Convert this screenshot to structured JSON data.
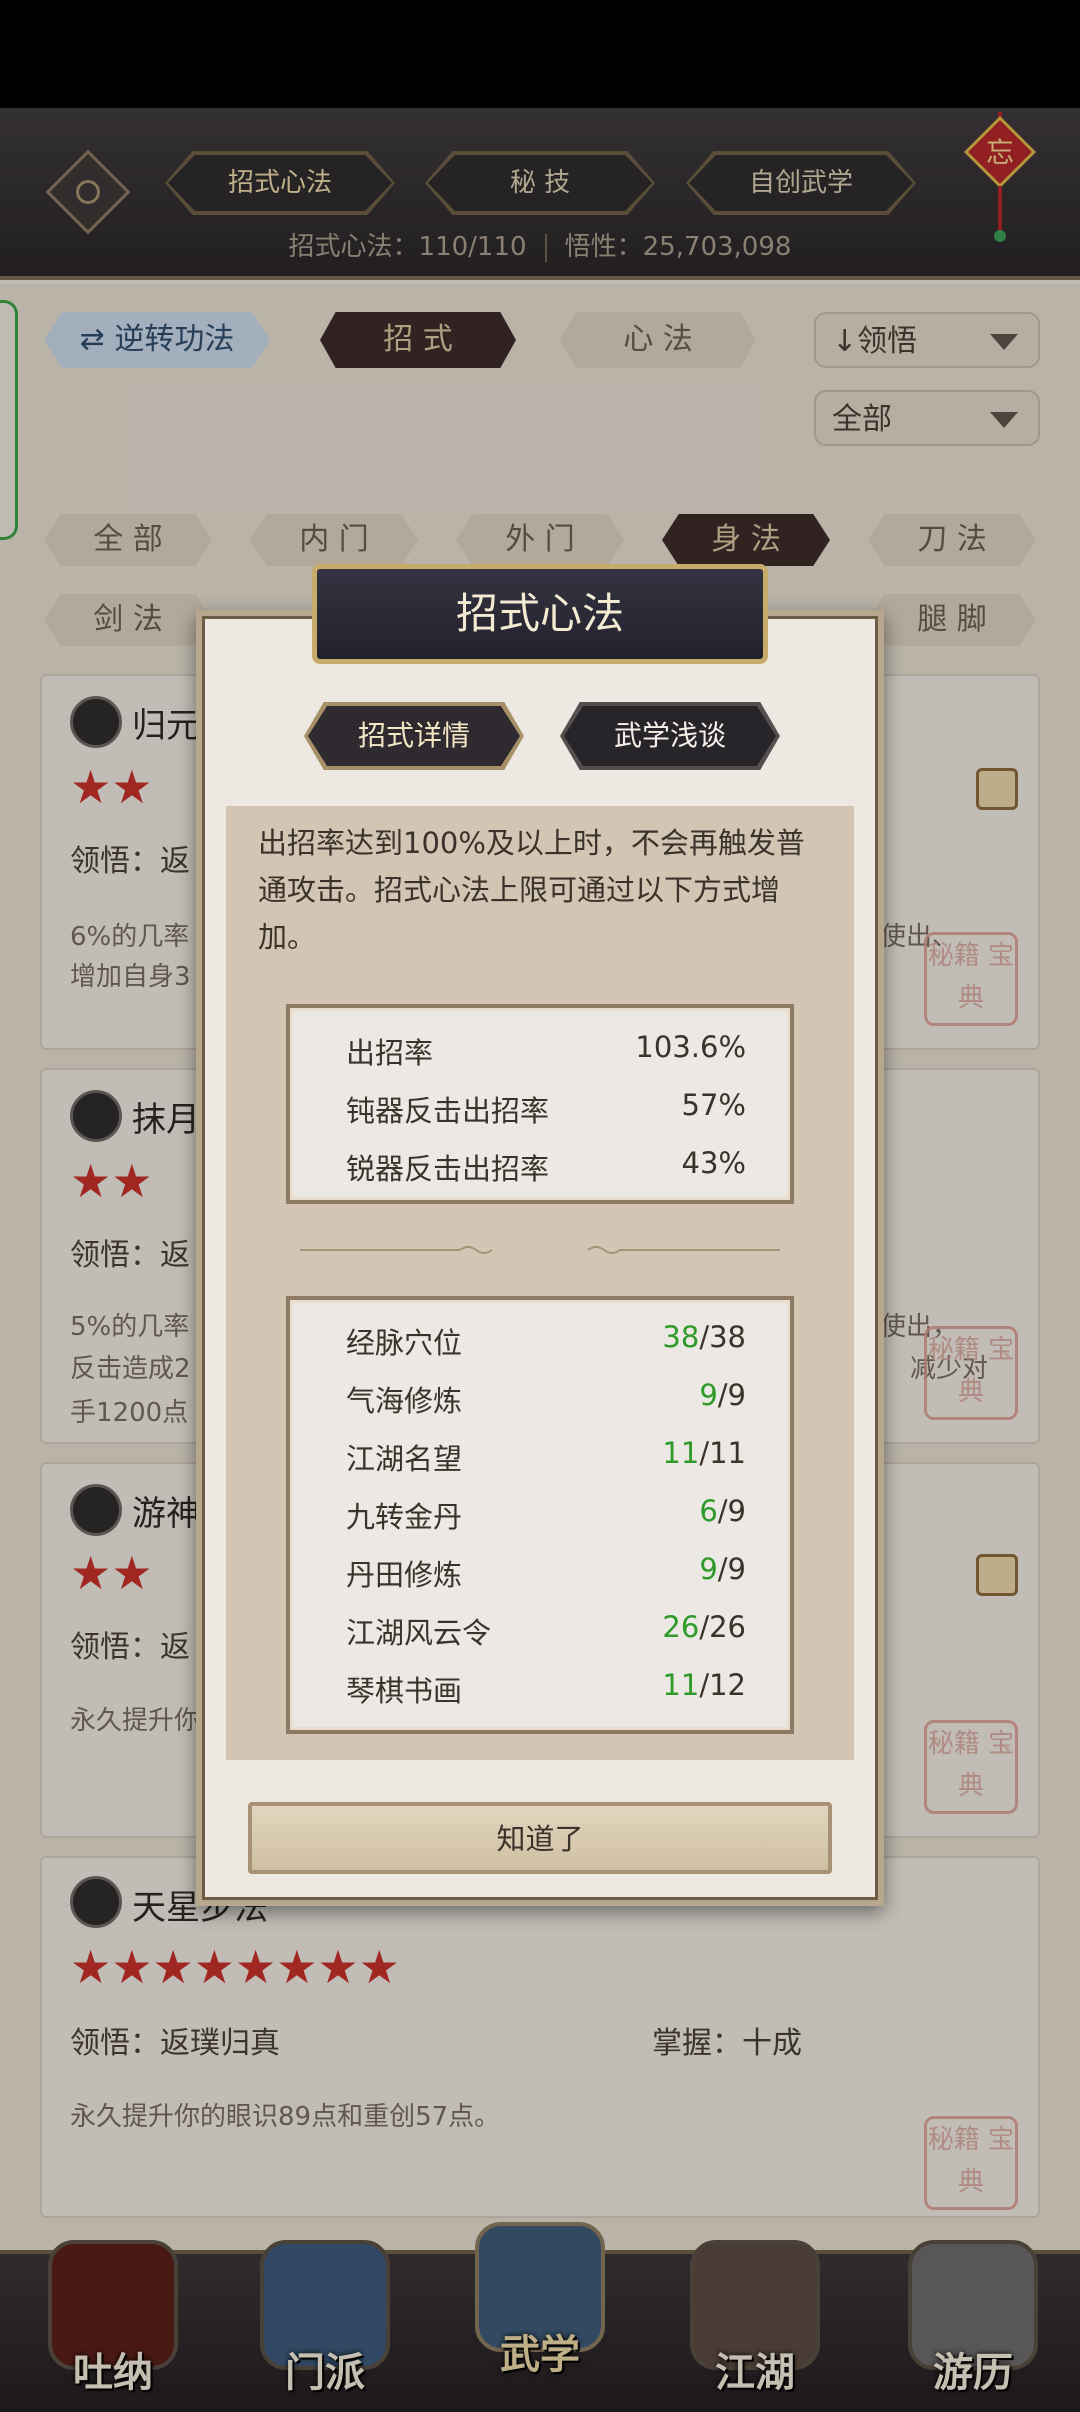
{
  "header": {
    "tabs": [
      "招式心法",
      "秘 技",
      "自创武学"
    ],
    "stats_label_left": "招式心法：110/110",
    "stats_label_right": "悟性：25,703,098",
    "knot_char": "忘"
  },
  "controls": {
    "reverse_label": "逆转功法",
    "moves_label": "招 式",
    "mind_label": "心 法",
    "sort_label": "领悟",
    "filter_label": "全部"
  },
  "categories": [
    "全 部",
    "内 门",
    "外 门",
    "身 法",
    "刀 法",
    "剑 法",
    "腿 脚"
  ],
  "cards": [
    {
      "title": "归元",
      "stars": "★★",
      "meta": "领悟：返",
      "desc1": "6%的几率",
      "desc2": "增加自身3",
      "desc_tail": "使出、"
    },
    {
      "title": "抹月",
      "stars": "★★",
      "meta": "领悟：返",
      "desc1": "5%的几率",
      "desc2": "反击造成2",
      "desc3": "手1200点",
      "desc_tail": "使出，",
      "desc_tail2": "减少对"
    },
    {
      "title": "游神",
      "stars": "★★",
      "meta": "领悟：返",
      "desc1": "永久提升你"
    },
    {
      "title": "天星步法",
      "stars": "★★★★★★★★",
      "meta": "领悟：返璞归真",
      "mastery": "掌握：十成",
      "desc1": "永久提升你的眼识89点和重创57点。"
    }
  ],
  "seal_text": "秘籍 宝典",
  "modal": {
    "title": "招式心法",
    "tab_detail": "招式详情",
    "tab_intro": "武学浅谈",
    "intro": "出招率达到100%及以上时，不会再触发普通攻击。招式心法上限可通过以下方式增加。",
    "rates": [
      {
        "label": "出招率",
        "value": "103.6%"
      },
      {
        "label": "钝器反击出招率",
        "value": "57%"
      },
      {
        "label": "锐器反击出招率",
        "value": "43%"
      }
    ],
    "sources": [
      {
        "label": "经脉穴位",
        "have": "38",
        "max": "/38"
      },
      {
        "label": "气海修炼",
        "have": "9",
        "max": "/9"
      },
      {
        "label": "江湖名望",
        "have": "11",
        "max": "/11"
      },
      {
        "label": "九转金丹",
        "have": "6",
        "max": "/9"
      },
      {
        "label": "丹田修炼",
        "have": "9",
        "max": "/9"
      },
      {
        "label": "江湖风云令",
        "have": "26",
        "max": "/26"
      },
      {
        "label": "琴棋书画",
        "have": "11",
        "max": "/12"
      }
    ],
    "ok_label": "知道了"
  },
  "nav": [
    "吐纳",
    "门派",
    "武学",
    "江湖",
    "游历"
  ],
  "colors": {
    "accent_green": "#2e9a2a",
    "star_red": "#c5302a",
    "modal_gold": "#c6ab6b"
  }
}
